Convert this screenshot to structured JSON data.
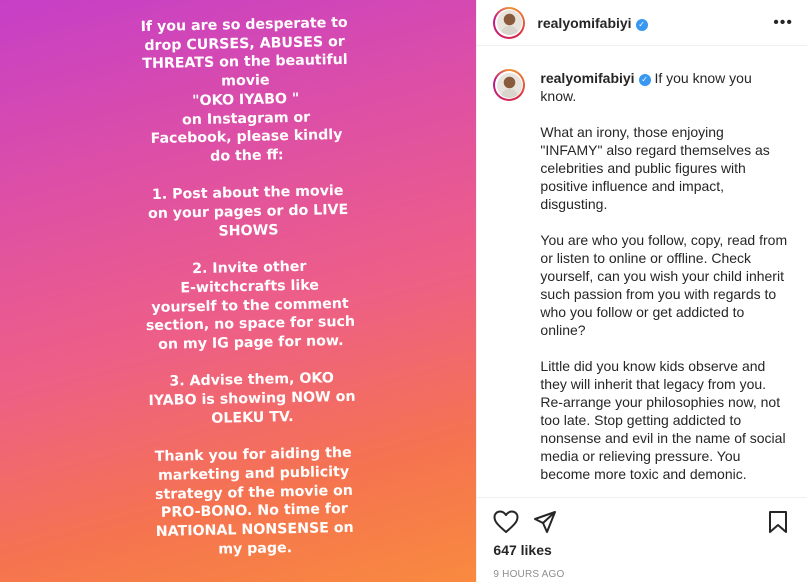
{
  "media": {
    "story_text": "If you are so desperate to\ndrop CURSES, ABUSES or\nTHREATS on the beautiful\nmovie\n\"OKO IYABO \"\non Instagram or\nFacebook, please kindly\ndo the ff:\n\n1. Post about the movie\non your pages or do LIVE\nSHOWS\n\n2. Invite other\nE-witchcrafts like\nyourself to the comment\nsection, no space for such\non my IG page for now.\n\n3. Advise them, OKO\nIYABO is showing NOW on\nOLEKU TV.\n\nThank you for aiding the\nmarketing and publicity\nstrategy of the movie on\nPRO-BONO. No time for\nNATIONAL NONSENSE on\nmy page."
  },
  "header": {
    "username": "realyomifabiyi",
    "verified_icon": "verified-badge-icon",
    "more_icon": "more-options-icon"
  },
  "caption": {
    "username": "realyomifabiyi",
    "first_line": "If you know you know.",
    "paragraphs": [
      "What an irony, those enjoying \"INFAMY\" also regard themselves as celebrities and public figures with positive influence and impact, disgusting.",
      "You are who you follow, copy, read from or listen to online or offline. Check yourself, can you wish your child inherit such passion from you with regards to who you follow or get addicted to online?",
      "Little did you know kids observe and they will inherit that legacy from you. Re-arrange your philosophies now, not too late. Stop getting addicted to nonsense and evil in the name of social media or relieving pressure. You become more toxic and demonic."
    ]
  },
  "actions": {
    "like_icon": "heart-icon",
    "share_icon": "paper-plane-icon",
    "save_icon": "bookmark-icon",
    "likes": "647 likes",
    "time": "9 HOURS AGO"
  },
  "colors": {
    "gradient_top": "#c63fc7",
    "gradient_bottom": "#f98a3f",
    "verified": "#3897f0",
    "text": "#262626",
    "muted": "#8e8e8e"
  }
}
